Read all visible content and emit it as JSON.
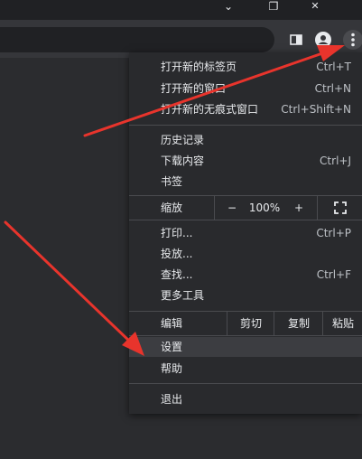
{
  "window_controls": {
    "chevron": "⌄",
    "restore": "❐",
    "close": "✕"
  },
  "menu": {
    "new_tab": {
      "label": "打开新的标签页",
      "shortcut": "Ctrl+T"
    },
    "new_window": {
      "label": "打开新的窗口",
      "shortcut": "Ctrl+N"
    },
    "new_incognito": {
      "label": "打开新的无痕式窗口",
      "shortcut": "Ctrl+Shift+N"
    },
    "history": {
      "label": "历史记录"
    },
    "downloads": {
      "label": "下载内容",
      "shortcut": "Ctrl+J"
    },
    "bookmarks": {
      "label": "书签"
    },
    "zoom": {
      "label": "缩放",
      "minus": "−",
      "level": "100%",
      "plus": "+"
    },
    "print": {
      "label": "打印...",
      "shortcut": "Ctrl+P"
    },
    "cast": {
      "label": "投放..."
    },
    "find": {
      "label": "查找...",
      "shortcut": "Ctrl+F"
    },
    "more_tools": {
      "label": "更多工具"
    },
    "edit": {
      "label": "编辑",
      "cut": "剪切",
      "copy": "复制",
      "paste": "粘贴"
    },
    "settings": {
      "label": "设置"
    },
    "help": {
      "label": "帮助"
    },
    "exit": {
      "label": "退出"
    }
  },
  "colors": {
    "arrow": "#e8342c",
    "menu_bg": "#292a2d",
    "highlight": "#3c3d41"
  }
}
